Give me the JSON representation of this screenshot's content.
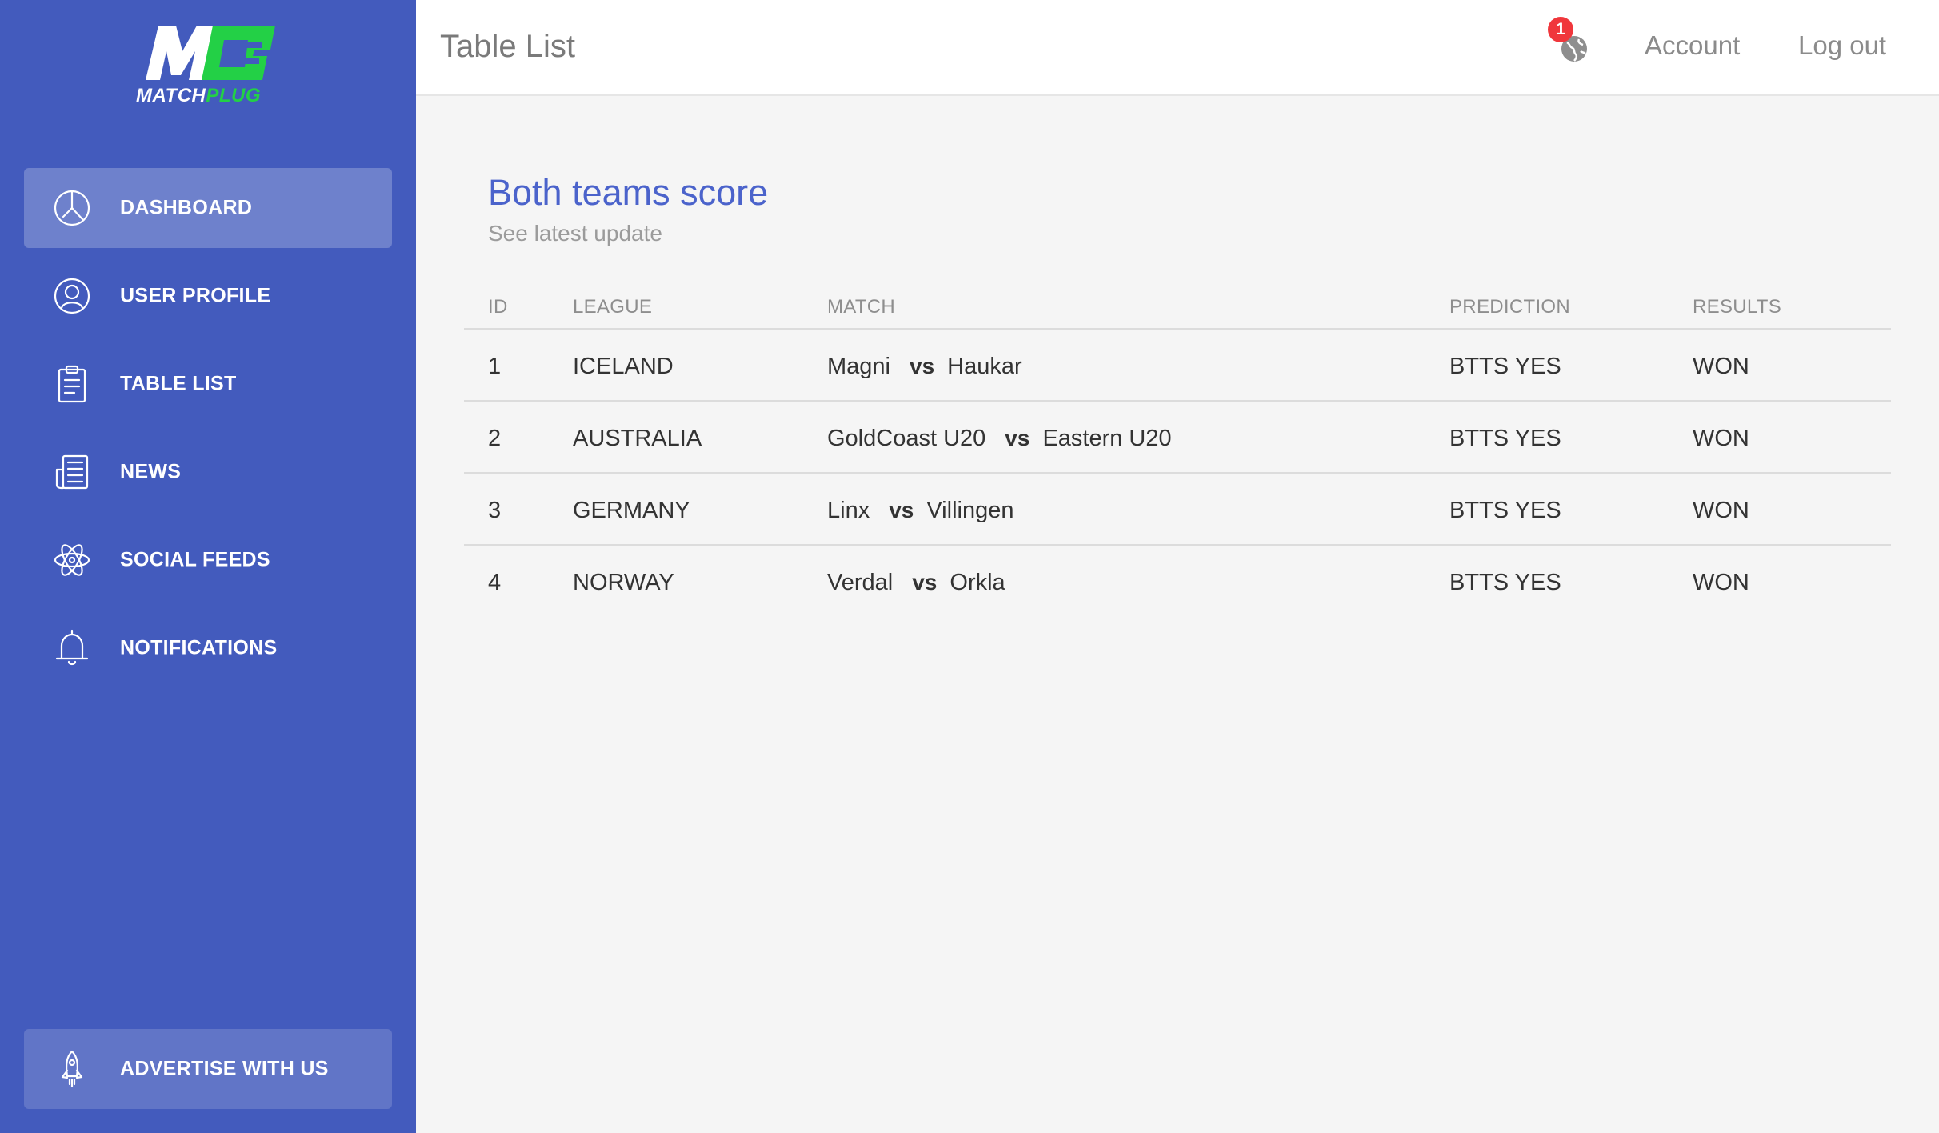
{
  "brand": {
    "logo_mark": "M",
    "name_part1": "MATCH",
    "name_part2": "PLUG",
    "green": "#23d046",
    "sidebar_color": "#435bbd"
  },
  "sidebar": {
    "items": [
      {
        "label": "DASHBOARD",
        "icon": "pie-chart-icon",
        "active": true
      },
      {
        "label": "USER PROFILE",
        "icon": "user-icon"
      },
      {
        "label": "TABLE LIST",
        "icon": "clipboard-icon"
      },
      {
        "label": "NEWS",
        "icon": "newspaper-icon"
      },
      {
        "label": "SOCIAL FEEDS",
        "icon": "atom-icon"
      },
      {
        "label": "NOTIFICATIONS",
        "icon": "bell-icon"
      }
    ],
    "advertise": {
      "label": "ADVERTISE WITH US",
      "icon": "rocket-icon"
    }
  },
  "header": {
    "title": "Table List",
    "notification_count": "1",
    "account": "Account",
    "logout": "Log out"
  },
  "card": {
    "title": "Both teams score",
    "subtitle": "See latest update",
    "columns": [
      "ID",
      "LEAGUE",
      "MATCH",
      "PREDICTION",
      "RESULTS"
    ],
    "vs_label": "vs",
    "rows": [
      {
        "id": "1",
        "league": "ICELAND",
        "home": "Magni",
        "away": "Haukar",
        "prediction": "BTTS YES",
        "result": "WON"
      },
      {
        "id": "2",
        "league": "AUSTRALIA",
        "home": "GoldCoast U20",
        "away": "Eastern U20",
        "prediction": "BTTS YES",
        "result": "WON"
      },
      {
        "id": "3",
        "league": "GERMANY",
        "home": "Linx",
        "away": "Villingen",
        "prediction": "BTTS YES",
        "result": "WON"
      },
      {
        "id": "4",
        "league": "NORWAY",
        "home": "Verdal",
        "away": "Orkla",
        "prediction": "BTTS YES",
        "result": "WON"
      }
    ]
  }
}
